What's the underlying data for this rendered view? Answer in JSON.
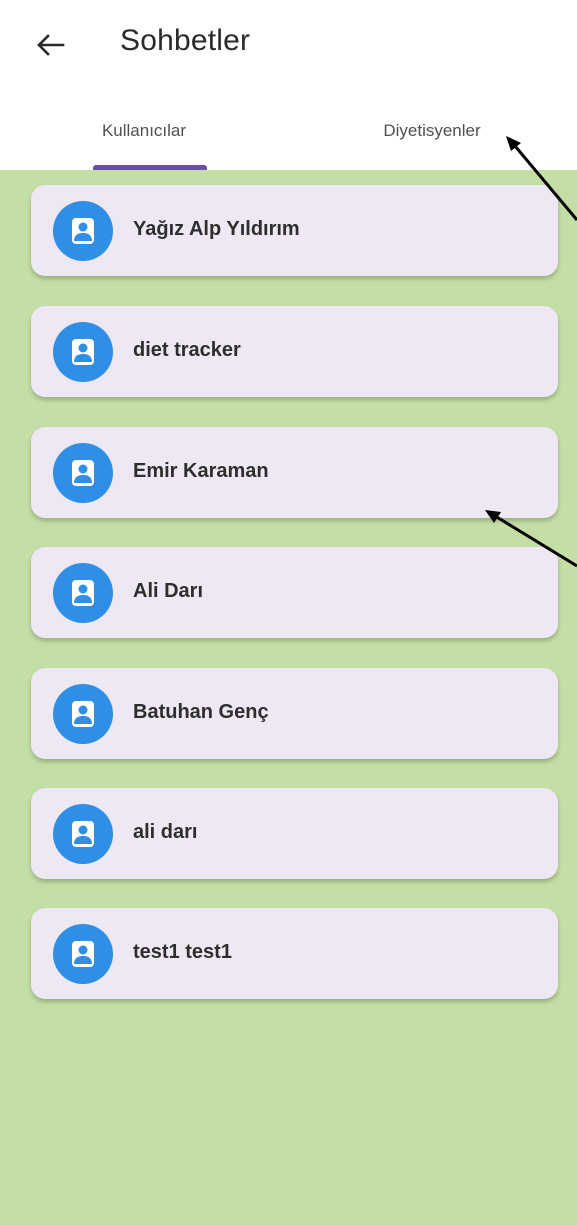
{
  "header": {
    "title": "Sohbetler",
    "back_icon": "arrow-left-icon"
  },
  "tabs": [
    {
      "label": "Kullanıcılar",
      "selected": true
    },
    {
      "label": "Diyetisyenler",
      "selected": false
    }
  ],
  "colors": {
    "content_bg": "#c4dfa5",
    "card_bg": "#ede8f3",
    "avatar_bg": "#2f8ee6",
    "tab_indicator": "#6a4fa5"
  },
  "users": [
    {
      "name": "Yağız Alp Yıldırım",
      "icon": "person-icon"
    },
    {
      "name": "diet tracker",
      "icon": "person-icon"
    },
    {
      "name": "Emir Karaman",
      "icon": "person-icon"
    },
    {
      "name": "Ali Darı",
      "icon": "person-icon"
    },
    {
      "name": "Batuhan Genç",
      "icon": "person-icon"
    },
    {
      "name": "ali darı",
      "icon": "person-icon"
    },
    {
      "name": "test1 test1",
      "icon": "person-icon"
    }
  ]
}
